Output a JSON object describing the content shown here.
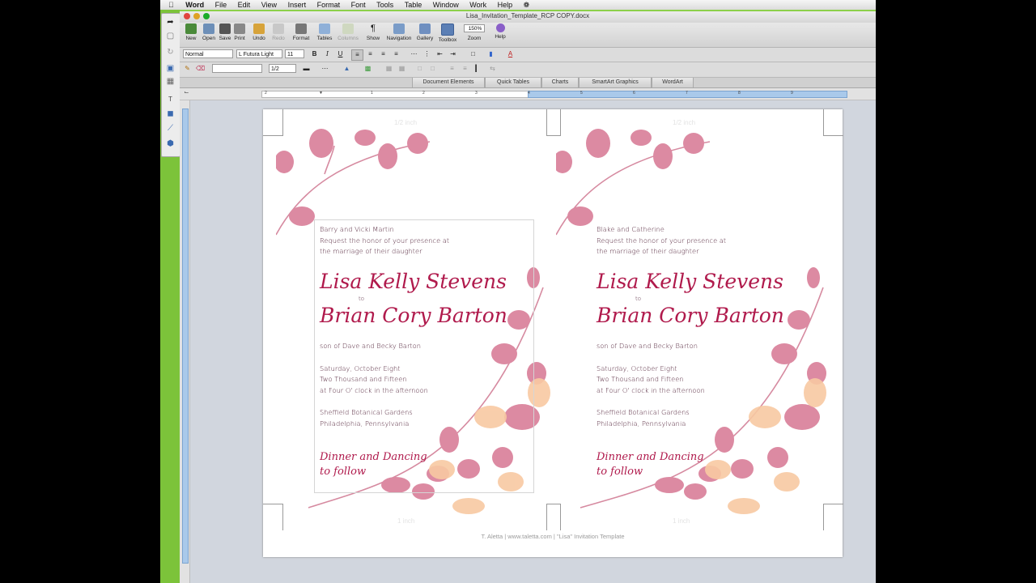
{
  "menubar": {
    "apple": "",
    "items": [
      "Word",
      "File",
      "Edit",
      "View",
      "Insert",
      "Format",
      "Font",
      "Tools",
      "Table",
      "Window",
      "Work",
      "Help"
    ]
  },
  "window": {
    "title": "Lisa_Invitation_Template_RCP COPY.docx"
  },
  "toolbar": {
    "buttons": [
      "New",
      "Open",
      "Save",
      "Print",
      "Undo",
      "Redo",
      "Format",
      "Tables",
      "Columns",
      "Show",
      "Navigation",
      "Gallery",
      "Toolbox",
      "Zoom",
      "Help"
    ],
    "zoom_value": "150%"
  },
  "format_bar": {
    "style": "Normal",
    "font": "L Futura Light",
    "size": "11",
    "bold": "B",
    "italic": "I",
    "underline": "U",
    "line_weight": "1/2"
  },
  "ribbon": {
    "tabs": [
      "Document Elements",
      "Quick Tables",
      "Charts",
      "SmartArt Graphics",
      "WordArt"
    ]
  },
  "ruler": {
    "numbers": [
      "2",
      "1",
      "1",
      "2",
      "3",
      "4",
      "5",
      "6",
      "7",
      "8",
      "9"
    ]
  },
  "document": {
    "cards": [
      {
        "parents": "Barry and Vicki Martin",
        "request1": "Request the honor of your presence at",
        "request2": "the marriage of their daughter",
        "bride": "Lisa Kelly Stevens",
        "to": "to",
        "groom": "Brian Cory Barton",
        "son_of": "son of Dave and Becky Barton",
        "date1": "Saturday, October Eight",
        "date2": "Two Thousand and Fifteen",
        "time": "at Four O' clock in the afternoon",
        "venue1": "Sheffield Botanical Gardens",
        "venue2": "Philadelphia, Pennsylvania",
        "dinner1": "Dinner and Dancing",
        "dinner2": "to follow"
      },
      {
        "parents": "Blake and Catherine",
        "request1": "Request the honor of your presence at",
        "request2": "the marriage of their daughter",
        "bride": "Lisa Kelly Stevens",
        "to": "to",
        "groom": "Brian Cory Barton",
        "son_of": "son of Dave and Becky Barton",
        "date1": "Saturday, October Eight",
        "date2": "Two Thousand and Fifteen",
        "time": "at Four O' clock in the afternoon",
        "venue1": "Sheffield Botanical Gardens",
        "venue2": "Philadelphia, Pennsylvania",
        "dinner1": "Dinner and Dancing",
        "dinner2": "to follow"
      }
    ],
    "ghost": {
      "half_inch": "1/2 inch",
      "one_inch": "1 inch"
    },
    "footer": "T. Aletta   |   www.taletta.com   |   \"Lisa\" Invitation Template"
  },
  "colors": {
    "desktop_green": "#7cc33a",
    "script_color": "#b01a4c",
    "leaf_pink": "#dc8aa2",
    "leaf_peach": "#f8c9a2"
  }
}
